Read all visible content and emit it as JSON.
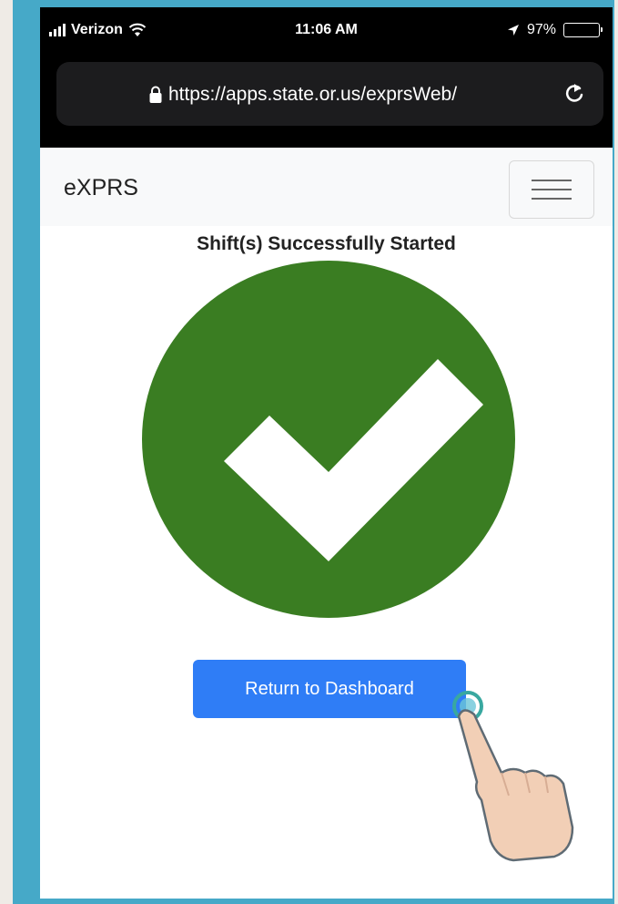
{
  "status_bar": {
    "carrier": "Verizon",
    "time": "11:06 AM",
    "battery": "97%",
    "battery_level": 0.97
  },
  "browser": {
    "url": "https://apps.state.or.us/exprsWeb/"
  },
  "navbar": {
    "brand": "eXPRS"
  },
  "main": {
    "title": "Shift(s) Successfully Started",
    "button_label": "Return to Dashboard"
  },
  "colors": {
    "frame": "#46a9c8",
    "check_circle": "#3a7d22",
    "button": "#2f7df6"
  },
  "icons": {
    "signal": "signal-icon",
    "wifi": "wifi-icon",
    "location": "location-icon",
    "battery": "battery-icon",
    "lock": "lock-icon",
    "reload": "reload-icon",
    "menu": "hamburger-menu-icon",
    "check": "checkmark-icon",
    "hand": "pointing-hand-icon"
  }
}
